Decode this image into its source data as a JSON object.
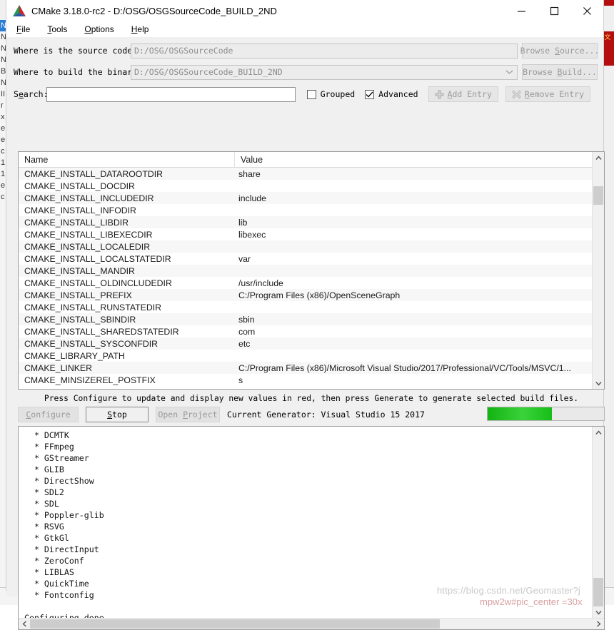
{
  "window": {
    "title": "CMake 3.18.0-rc2 - D:/OSG/OSGSourceCode_BUILD_2ND",
    "logo_name": "cmake-logo",
    "minimize_label": "─",
    "maximize_label": "☐",
    "close_label": "✕"
  },
  "menubar": {
    "items": [
      {
        "label": "File",
        "accel": "F"
      },
      {
        "label": "Tools",
        "accel": "T"
      },
      {
        "label": "Options",
        "accel": "O"
      },
      {
        "label": "Help",
        "accel": "H"
      }
    ]
  },
  "form": {
    "source_label": "Where is the source code:",
    "source_value": "D:/OSG/OSGSourceCode",
    "browse_source_label": "Browse Source...",
    "build_label": "Where to build the binaries:",
    "build_value": "D:/OSG/OSGSourceCode_BUILD_2ND",
    "browse_build_label": "Browse Build...",
    "search_label": "Search:",
    "search_value": "",
    "search_placeholder": "",
    "grouped_label": "Grouped",
    "grouped_checked": false,
    "advanced_label": "Advanced",
    "advanced_checked": true,
    "add_entry_label": "Add Entry",
    "remove_entry_label": "Remove Entry"
  },
  "cache_table": {
    "columns": [
      "Name",
      "Value"
    ],
    "rows": [
      {
        "name": "CMAKE_INSTALL_DATAROOTDIR",
        "value": "share"
      },
      {
        "name": "CMAKE_INSTALL_DOCDIR",
        "value": ""
      },
      {
        "name": "CMAKE_INSTALL_INCLUDEDIR",
        "value": "include"
      },
      {
        "name": "CMAKE_INSTALL_INFODIR",
        "value": ""
      },
      {
        "name": "CMAKE_INSTALL_LIBDIR",
        "value": "lib"
      },
      {
        "name": "CMAKE_INSTALL_LIBEXECDIR",
        "value": "libexec"
      },
      {
        "name": "CMAKE_INSTALL_LOCALEDIR",
        "value": ""
      },
      {
        "name": "CMAKE_INSTALL_LOCALSTATEDIR",
        "value": "var"
      },
      {
        "name": "CMAKE_INSTALL_MANDIR",
        "value": ""
      },
      {
        "name": "CMAKE_INSTALL_OLDINCLUDEDIR",
        "value": "/usr/include"
      },
      {
        "name": "CMAKE_INSTALL_PREFIX",
        "value": "C:/Program Files (x86)/OpenSceneGraph"
      },
      {
        "name": "CMAKE_INSTALL_RUNSTATEDIR",
        "value": ""
      },
      {
        "name": "CMAKE_INSTALL_SBINDIR",
        "value": "sbin"
      },
      {
        "name": "CMAKE_INSTALL_SHAREDSTATEDIR",
        "value": "com"
      },
      {
        "name": "CMAKE_INSTALL_SYSCONFDIR",
        "value": "etc"
      },
      {
        "name": "CMAKE_LIBRARY_PATH",
        "value": ""
      },
      {
        "name": "CMAKE_LINKER",
        "value": "C:/Program Files (x86)/Microsoft Visual Studio/2017/Professional/VC/Tools/MSVC/1..."
      },
      {
        "name": "CMAKE_MINSIZEREL_POSTFIX",
        "value": "s"
      }
    ]
  },
  "hint": "Press Configure to update and display new values in red, then press Generate to generate selected build files.",
  "actions": {
    "configure_label": "Configure",
    "configure_enabled": false,
    "stop_label": "Stop",
    "stop_enabled": true,
    "open_project_label": "Open Project",
    "open_project_enabled": false,
    "generator_text": "Current Generator: Visual Studio 15 2017",
    "progress_percent": 55,
    "progress_color": "#17bd17"
  },
  "output_log": "  * DCMTK\n  * FFmpeg\n  * GStreamer\n  * GLIB\n  * DirectShow\n  * SDL2\n  * SDL\n  * Poppler-glib\n  * RSVG\n  * GtkGl\n  * DirectInput\n  * ZeroConf\n  * LIBLAS\n  * QuickTime\n  * Fontconfig\n\nConfiguring done",
  "background": {
    "left_strip_items": [
      "NS",
      "NS",
      "NS",
      "NS",
      "B",
      "N",
      "II",
      "",
      "r",
      "x",
      "e",
      "e",
      "",
      "c",
      "",
      "1",
      "",
      "1",
      "e",
      "c"
    ],
    "left_selected_index": 0,
    "red_badge_text": "文"
  },
  "watermark": {
    "line1": "https://blog.csdn.net/Geomaster?j",
    "line2": "mpw2w#pic_center =30x"
  }
}
